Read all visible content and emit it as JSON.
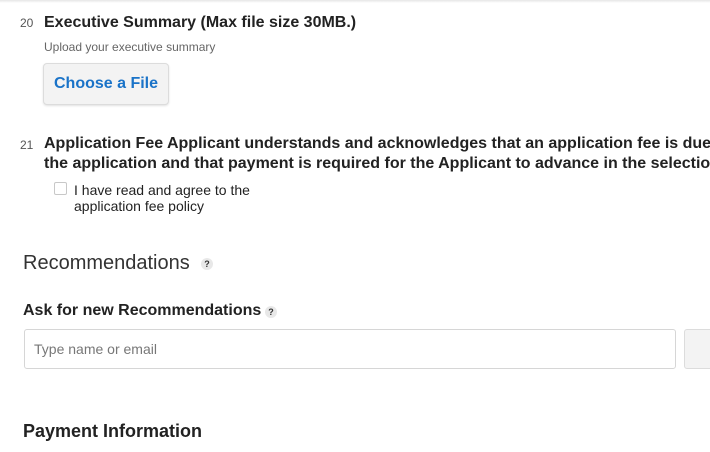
{
  "questions": [
    {
      "number": "20",
      "title": "Executive Summary (Max file size 30MB.)",
      "description": "Upload your executive summary",
      "button_label": "Choose a File"
    },
    {
      "number": "21",
      "title_line1": "Application Fee Applicant understands and acknowledges that an application fee is due u",
      "title_line2": "the application and that payment is required for the Applicant to advance in the selection",
      "checkbox_label": "I have read and agree to the application fee policy"
    }
  ],
  "recommendations": {
    "section_title": "Recommendations",
    "help_glyph": "?",
    "ask_title": "Ask for new Recommendations",
    "input_placeholder": "Type name or email"
  },
  "payment": {
    "title": "Payment Information"
  },
  "icons": {
    "help": "question-mark-icon"
  },
  "colors": {
    "link_blue": "#1a73c8"
  }
}
